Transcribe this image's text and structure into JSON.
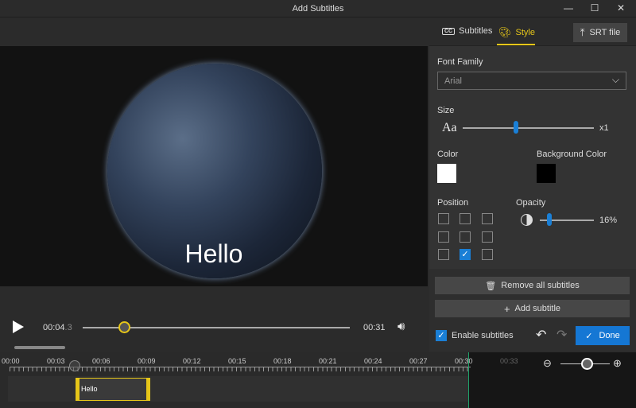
{
  "window": {
    "title": "Add Subtitles",
    "minimize": "—",
    "maximize": "☐",
    "close": "✕"
  },
  "video": {
    "subtitle": "Hello",
    "current_time": "00:04",
    "current_time_fraction": ".3",
    "duration": "00:31",
    "progress_percent": 14
  },
  "panel": {
    "tabs": [
      {
        "label": "Subtitles",
        "icon": "cc-icon"
      },
      {
        "label": "Style",
        "icon": "palette-icon",
        "active": true
      }
    ],
    "srt_button": "SRT file",
    "font_family_label": "Font Family",
    "font_family_value": "Arial",
    "size_label": "Size",
    "size_icon_text": "Aa",
    "size_value": "x1",
    "size_slider_percent": 41,
    "color_label": "Color",
    "color_value": "#ffffff",
    "bg_color_label": "Background Color",
    "bg_color_value": "#000000",
    "position_label": "Position",
    "position_selected": "bottom-center",
    "opacity_label": "Opacity",
    "opacity_value": "16%",
    "remove_all": "Remove all subtitles",
    "add_subtitle": "Add subtitle",
    "enable_subtitles": "Enable subtitles",
    "enable_checked": true,
    "done": "Done"
  },
  "timeline": {
    "ticks": [
      "00:00",
      "00:03",
      "00:06",
      "00:09",
      "00:12",
      "00:15",
      "00:18",
      "00:21",
      "00:24",
      "00:27",
      "00:30",
      "00:33"
    ],
    "clip_text": "Hello"
  },
  "colors": {
    "accent": "#e6c619",
    "primary": "#1577d4"
  }
}
